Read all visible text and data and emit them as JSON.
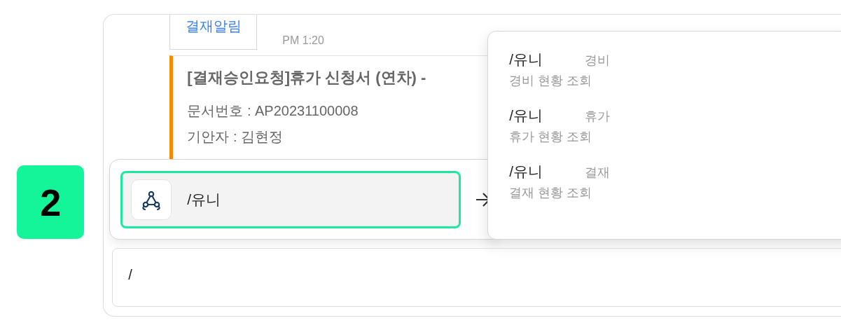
{
  "step_badge": "2",
  "notice": {
    "button": "결재알림",
    "time": "PM 1:20"
  },
  "approval": {
    "title": "[결재승인요청]휴가 신청서 (연차) -",
    "lines": [
      "문서번호 : AP20231100008",
      "기안자 : 김현정"
    ]
  },
  "command_chip": {
    "text": "/유니"
  },
  "suggestions": [
    {
      "command": "/유니",
      "category": "경비",
      "description": "경비 현황 조회"
    },
    {
      "command": "/유니",
      "category": "휴가",
      "description": "휴가 현황 조회"
    },
    {
      "command": "/유니",
      "category": "결재",
      "description": "결재 현황 조회"
    }
  ],
  "message_input": {
    "value": "/"
  }
}
